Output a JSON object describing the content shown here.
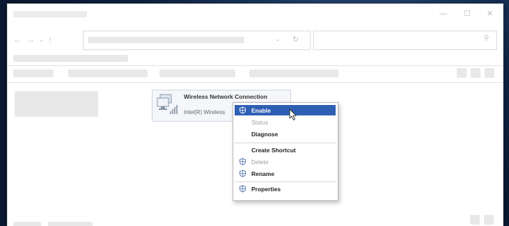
{
  "adapter": {
    "name": "Wireless Network Connection",
    "description": "Intel(R) Wireless",
    "icon": "network-adapter-icon"
  },
  "context_menu": {
    "items": [
      {
        "label": "Enable",
        "icon": "shield-icon",
        "highlighted": true,
        "disabled": false
      },
      {
        "label": "Status",
        "icon": "",
        "highlighted": false,
        "disabled": true
      },
      {
        "label": "Diagnose",
        "icon": "",
        "highlighted": false,
        "disabled": false
      },
      {
        "label": "Create Shortcut",
        "icon": "",
        "highlighted": false,
        "disabled": false
      },
      {
        "label": "Delete",
        "icon": "shield-icon",
        "highlighted": false,
        "disabled": true
      },
      {
        "label": "Rename",
        "icon": "shield-icon",
        "highlighted": false,
        "disabled": false
      },
      {
        "label": "Properties",
        "icon": "shield-icon",
        "highlighted": false,
        "disabled": false
      }
    ]
  },
  "colors": {
    "highlight": "#2f5fb3",
    "background": "#0b1a33"
  }
}
